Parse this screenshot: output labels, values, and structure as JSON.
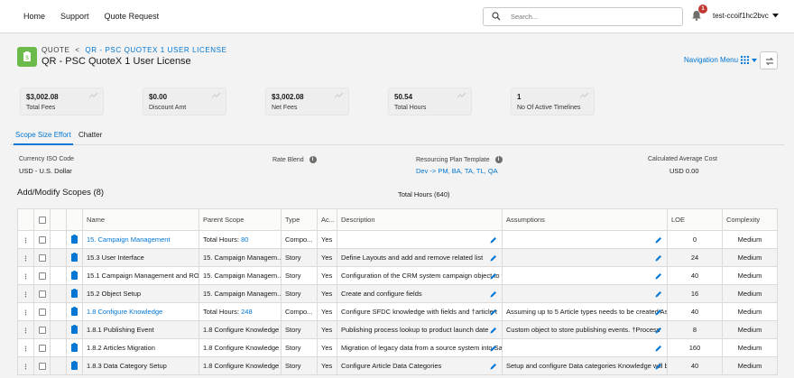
{
  "nav": {
    "links": [
      "Home",
      "Support",
      "Quote Request"
    ],
    "search_placeholder": "Search...",
    "notification_count": "1",
    "user_name": "test-ccoif1hc2bvc"
  },
  "header": {
    "object_label": "QUOTE",
    "separator": "<",
    "breadcrumb_link": "QR - PSC QUOTEX 1 USER LICENSE",
    "title": "QR - PSC QuoteX 1 User License",
    "nav_menu_label": "Navigation Menu"
  },
  "cards": [
    {
      "value": "$3,002.08",
      "label": "Total Fees"
    },
    {
      "value": "$0.00",
      "label": "Discount Amt"
    },
    {
      "value": "$3,002.08",
      "label": "Net Fees"
    },
    {
      "value": "50.54",
      "label": "Total Hours"
    },
    {
      "value": "1",
      "label": "No Of Active Timelines"
    }
  ],
  "tabs": [
    "Scope Size Effort",
    "Chatter"
  ],
  "fields": {
    "currency_label": "Currency ISO Code",
    "currency_value": "USD - U.S. Dollar",
    "rate_blend_label": "Rate Blend",
    "resourcing_label": "Resourcing Plan Template",
    "resourcing_value": "Dev -> PM, BA, TA, TL, QA",
    "avg_cost_label": "Calculated Average Cost",
    "avg_cost_value": "USD 0.00"
  },
  "section_title": "Add/Modify Scopes (8)",
  "total_hours_text": "Total Hours  (640)",
  "table": {
    "columns": [
      "Name",
      "Parent Scope",
      "Type",
      "Ac...",
      "Description",
      "Assumptions",
      "LOE",
      "Complexity"
    ],
    "rows": [
      {
        "name": "15. Campaign Management",
        "name_link": true,
        "parent": "Total Hours: ",
        "parent_link": "80",
        "type": "Compo...",
        "active": "Yes",
        "description": "",
        "assumptions": "",
        "loe": "0",
        "complexity": "Medium"
      },
      {
        "name": "15.3 User Interface",
        "name_link": false,
        "parent": "15. Campaign Managem...",
        "parent_link": "",
        "type": "Story",
        "active": "Yes",
        "description": "Define Layouts and add and remove related list",
        "assumptions": "",
        "loe": "24",
        "complexity": "Medium"
      },
      {
        "name": "15.1 Campaign Management and ROI",
        "name_link": false,
        "parent": "15. Campaign Managem...",
        "parent_link": "",
        "type": "Story",
        "active": "Yes",
        "description": "Configuration of the CRM system campaign object to t",
        "assumptions": "",
        "loe": "40",
        "complexity": "Medium"
      },
      {
        "name": "15.2 Object Setup",
        "name_link": false,
        "parent": "15. Campaign Managem...",
        "parent_link": "",
        "type": "Story",
        "active": "Yes",
        "description": "Create and configure fields",
        "assumptions": "",
        "loe": "16",
        "complexity": "Medium"
      },
      {
        "name": "1.8 Configure Knowledge",
        "name_link": true,
        "parent": "Total Hours: ",
        "parent_link": "248",
        "type": "Compo...",
        "active": "Yes",
        "description": "Configure SFDC knowledge with fields and    †article t",
        "assumptions": "Assuming up to 5 Article types needs to be created As",
        "loe": "40",
        "complexity": "Medium"
      },
      {
        "name": "1.8.1 Publishing Event",
        "name_link": false,
        "parent": "1.8 Configure Knowledge",
        "parent_link": "",
        "type": "Story",
        "active": "Yes",
        "description": "Publishing process lookup to product launch date",
        "assumptions": "Custom object to store publishing events.     †Process",
        "loe": "8",
        "complexity": "Medium"
      },
      {
        "name": "1.8.2 Articles Migration",
        "name_link": false,
        "parent": "1.8 Configure Knowledge",
        "parent_link": "",
        "type": "Story",
        "active": "Yes",
        "description": "Migration of legacy data from a source system into Sal",
        "assumptions": "",
        "loe": "160",
        "complexity": "Medium"
      },
      {
        "name": "1.8.3 Data Category Setup",
        "name_link": false,
        "parent": "1.8 Configure Knowledge",
        "parent_link": "",
        "type": "Story",
        "active": "Yes",
        "description": "Configure Article Data Categories",
        "assumptions": "Setup and configure Data categories Knowledge will be",
        "loe": "40",
        "complexity": "Medium"
      }
    ]
  },
  "colors": {
    "brand_blue": "#0176d3",
    "record_icon": "#6cba4b",
    "badge": "#c23934"
  }
}
